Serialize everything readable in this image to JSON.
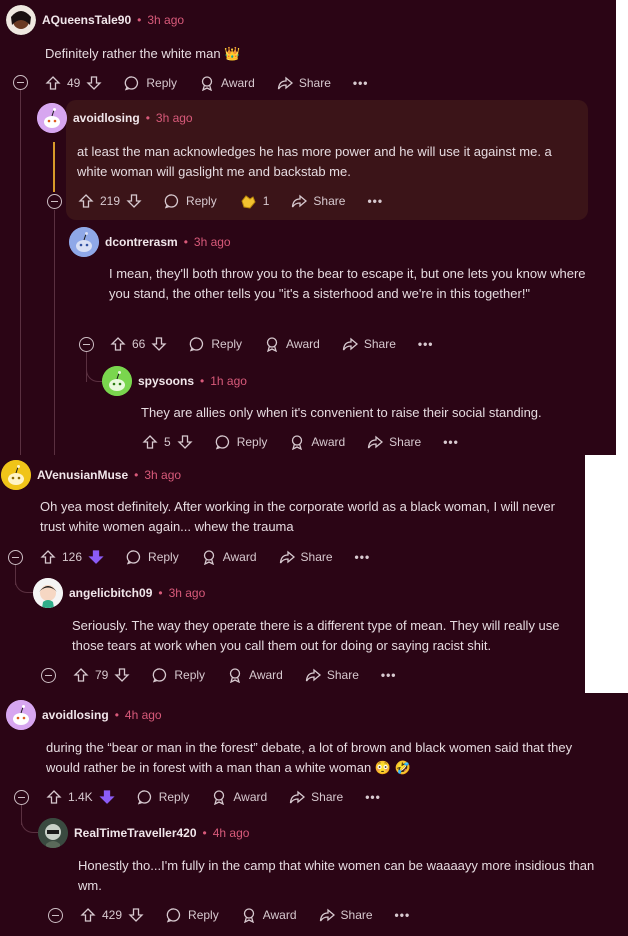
{
  "comments": [
    {
      "user": "AQueensTale90",
      "time": "3h ago",
      "body": "Definitely rather the white man 👑",
      "votes": "49",
      "reply": "Reply",
      "award": "Award",
      "share": "Share"
    },
    {
      "user": "avoidlosing",
      "time": "3h ago",
      "body": "at least the man acknowledges he has more power and he will use it against me. a white woman will gaslight me and backstab me.",
      "votes": "219",
      "reply": "Reply",
      "award_count": "1",
      "share": "Share"
    },
    {
      "user": "dcontrerasm",
      "time": "3h ago",
      "body": "I mean, they'll both throw you to the bear to escape it, but one lets you know where you stand, the other tells you \"it's a sisterhood and we're in this together!\"",
      "votes": "66",
      "reply": "Reply",
      "award": "Award",
      "share": "Share"
    },
    {
      "user": "spysoons",
      "time": "1h ago",
      "body": "They are allies only when it's convenient to raise their social standing.",
      "votes": "5",
      "reply": "Reply",
      "award": "Award",
      "share": "Share"
    },
    {
      "user": "AVenusianMuse",
      "time": "3h ago",
      "body": "Oh yea most definitely. After working in the corporate world as a black woman, I will never trust white women again... whew the trauma",
      "votes": "126",
      "reply": "Reply",
      "award": "Award",
      "share": "Share"
    },
    {
      "user": "angelicbitch09",
      "time": "3h ago",
      "body": "Seriously. The way they operate there is a different type of mean. They will really use those tears at work when you call them out for doing or saying racist shit.",
      "votes": "79",
      "reply": "Reply",
      "award": "Award",
      "share": "Share"
    },
    {
      "user": "avoidlosing",
      "time": "4h ago",
      "body": "during the “bear or man in the forest” debate, a lot of brown and black women said that they would rather be in forest with a man than a white woman 😳 🤣",
      "votes": "1.4K",
      "reply": "Reply",
      "award": "Award",
      "share": "Share"
    },
    {
      "user": "RealTimeTraveller420",
      "time": "4h ago",
      "body": "Honestly tho...I'm fully in the camp that white women can be waaaayy more insidious than wm.",
      "votes": "429",
      "reply": "Reply",
      "award": "Award",
      "share": "Share"
    }
  ],
  "more_label": "•••",
  "separator": "•",
  "colors": {
    "background": "#2b0515",
    "highlight": "#3b1418",
    "downvote_active": "#8b5cf6",
    "time": "#d85a7a"
  }
}
